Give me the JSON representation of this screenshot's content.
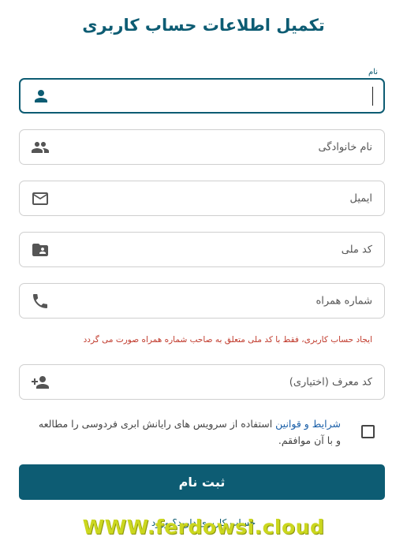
{
  "page": {
    "title": "تکمیل اطلاعات حساب کاربری"
  },
  "form": {
    "first_name_label": "نام",
    "last_name_placeholder": "نام خانوادگی",
    "email_placeholder": "ایمیل",
    "national_code_placeholder": "کد ملی",
    "mobile_placeholder": "شماره همراه",
    "warning": "ایجاد حساب کاربری، فقط با کد ملی متعلق به صاحب شماره همراه صورت می گردد",
    "referral_placeholder": "کد معرف (اختیاری)",
    "terms_link": "شرایط و قوانین",
    "terms_text": " استفاده از سرویس های رایانش ابری فردوسی را مطالعه و با آن موافقم.",
    "submit_label": "ثبت نام",
    "login_prompt": "حساب کاربری دارید؟ ورود"
  },
  "watermark": "WWW.ferdowsi.cloud",
  "colors": {
    "primary": "#0d5c73",
    "warning": "#c0392b",
    "link": "#1a5fa8",
    "watermark": "#cbd71f"
  },
  "icons": {
    "first_name": "person-icon",
    "last_name": "people-icon",
    "email": "mail-icon",
    "national_code": "id-card-folder-icon",
    "mobile": "phone-icon",
    "referral": "person-add-icon"
  }
}
